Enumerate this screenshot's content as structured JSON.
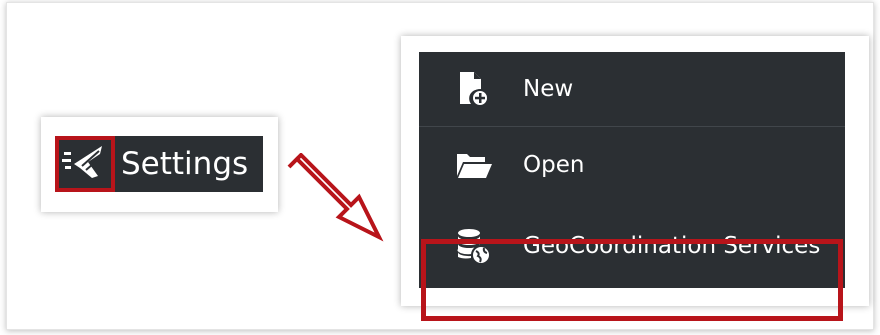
{
  "settings": {
    "label": "Settings",
    "icon": "tools-icon",
    "highlight_color": "#b8141a"
  },
  "menu": {
    "items": [
      {
        "label": "New",
        "icon": "new-file-icon"
      },
      {
        "label": "Open",
        "icon": "folder-open-icon"
      },
      {
        "label": "GeoCoordination Services",
        "icon": "database-globe-icon",
        "highlighted": true
      }
    ]
  },
  "colors": {
    "menu_background": "#2b2f33",
    "highlight": "#b8141a",
    "text": "#ffffff"
  }
}
